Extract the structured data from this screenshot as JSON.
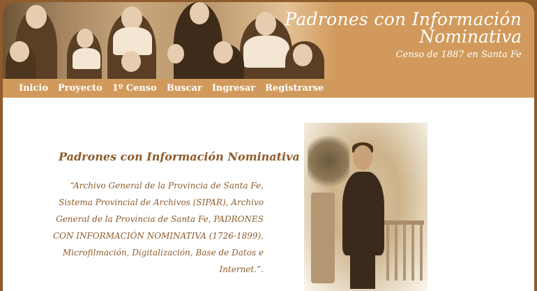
{
  "header": {
    "title_line1": "Padrones con Información",
    "title_line2": "Nominativa",
    "subtitle": "Censo de 1887 en Santa Fe"
  },
  "nav": {
    "items": [
      {
        "label": "Inicio"
      },
      {
        "label": "Proyecto"
      },
      {
        "label": "1º Censo"
      },
      {
        "label": "Buscar"
      },
      {
        "label": "Ingresar"
      },
      {
        "label": "Registrarse"
      }
    ]
  },
  "content": {
    "title": "Padrones con Información Nominativa",
    "quote_lines": [
      "“Archivo General de la Provincia de Santa Fe,",
      "Sistema Provincial de Archivos (SIPAR), Archivo",
      "General de la Provincia de Santa Fe, PADRONES",
      "CON INFORMACIÓN NOMINATIVA (1726-1899),",
      "Microfilmación, Digitalización, Base de Datos e",
      "Internet.”."
    ]
  },
  "colors": {
    "frame": "#8d5b2c",
    "header": "#d19a5c",
    "text_accent": "#8d5b2c"
  }
}
